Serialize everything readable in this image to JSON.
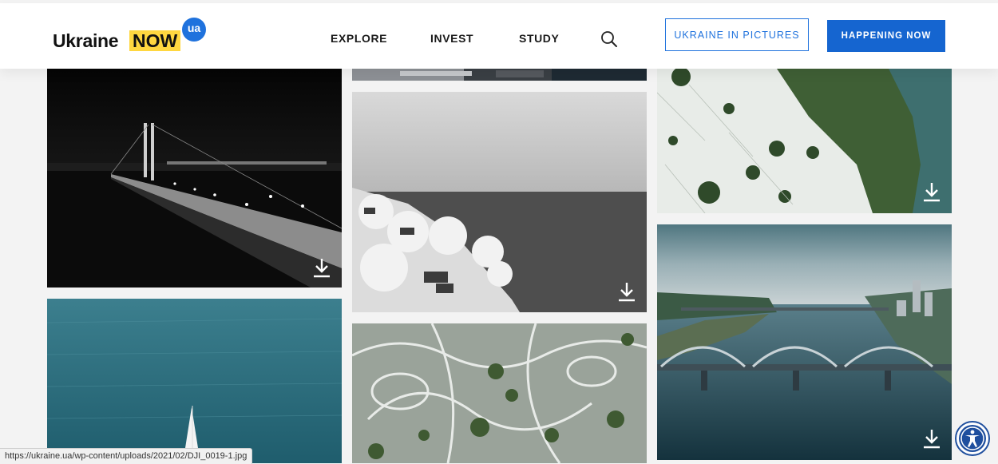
{
  "header": {
    "logo": {
      "word1": "Ukraine",
      "word2": "NOW",
      "badge": "ua"
    },
    "nav": [
      {
        "label": "EXPLORE"
      },
      {
        "label": "INVEST"
      },
      {
        "label": "STUDY"
      }
    ],
    "search_icon": "search-icon",
    "cta_outline": "UKRAINE IN PICTURES",
    "cta_solid": "HAPPENING NOW"
  },
  "gallery": {
    "photos": [
      {
        "subject": "night bridge",
        "download_icon": "download-icon"
      },
      {
        "subject": "snowy riverbank",
        "download_icon": "download-icon"
      },
      {
        "subject": "aerial snowy forest and river",
        "download_icon": "download-icon"
      },
      {
        "subject": "arch bridge over river",
        "download_icon": "download-icon"
      },
      {
        "subject": "sea with sailboat"
      },
      {
        "subject": "aerial snowy park"
      },
      {
        "subject": "aerial city strip"
      }
    ]
  },
  "status_bar": {
    "url": "https://ukraine.ua/wp-content/uploads/2021/02/DJI_0019-1.jpg"
  },
  "accessibility": {
    "icon": "accessibility-icon"
  },
  "colors": {
    "brand_blue": "#1565d0",
    "logo_yellow": "#ffd740",
    "badge_blue": "#1f72dd"
  }
}
